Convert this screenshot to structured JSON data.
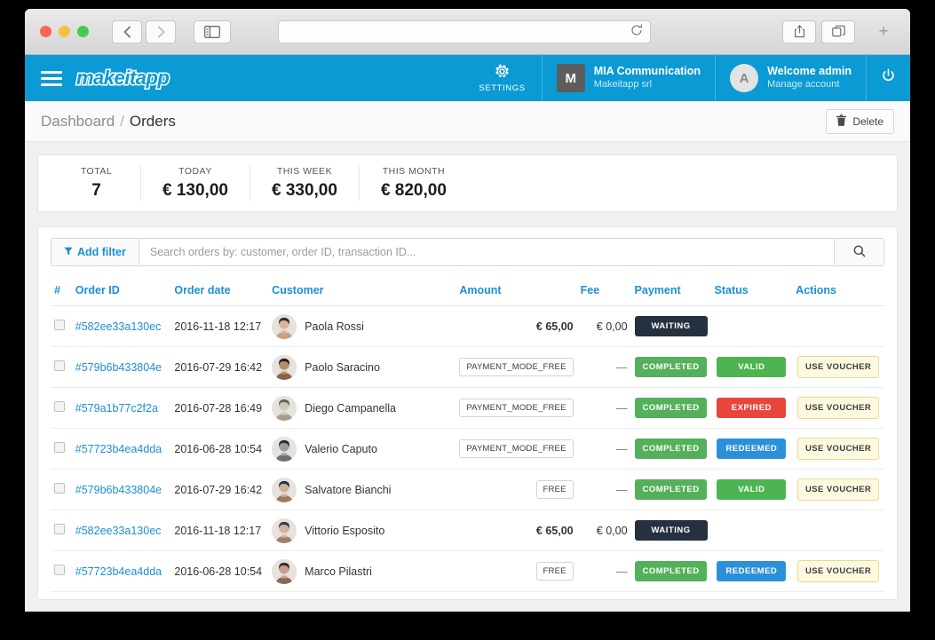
{
  "browser": {
    "back_icon": "chevron-left-icon",
    "forward_icon": "chevron-right-icon",
    "sidebar_icon": "sidebar-toggle-icon",
    "url_value": "",
    "url_placeholder": "",
    "reload_icon": "reload-icon",
    "share_icon": "share-icon",
    "tabs_icon": "show-tabs-icon",
    "new_tab_label": "+"
  },
  "navbar": {
    "brand": "makeitapp",
    "settings": {
      "label": "SETTINGS",
      "icon": "gear-icon"
    },
    "company": {
      "initial": "M",
      "name": "MIA Communication",
      "subtitle": "Makeitapp srl"
    },
    "account": {
      "initial": "A",
      "name": "Welcome admin",
      "subtitle": "Manage account"
    },
    "power": {
      "icon": "power-icon"
    },
    "menu_icon": "hamburger-menu-icon"
  },
  "breadcrumb": {
    "parent": "Dashboard",
    "separator": "/",
    "current": "Orders",
    "delete_label": "Delete",
    "delete_icon": "trash-icon"
  },
  "stats": [
    {
      "label": "TOTAL",
      "value": "7"
    },
    {
      "label": "TODAY",
      "value": "€ 130,00"
    },
    {
      "label": "THIS WEEK",
      "value": "€ 330,00"
    },
    {
      "label": "THIS MONTH",
      "value": "€ 820,00"
    }
  ],
  "filter": {
    "add_filter_label": "Add filter",
    "filter_icon": "funnel-icon",
    "search_value": "",
    "search_placeholder": "Search orders by: customer, order ID, transaction ID...",
    "search_icon": "search-icon"
  },
  "table": {
    "columns": {
      "index": "#",
      "order_id": "Order ID",
      "order_date": "Order date",
      "customer": "Customer",
      "amount": "Amount",
      "fee": "Fee",
      "payment": "Payment",
      "status": "Status",
      "actions": "Actions"
    },
    "rows": [
      {
        "order_id": "#582ee33a130ec",
        "order_date": "2016-11-18 12:17",
        "customer": "Paola Rossi",
        "avatar": "avatar-paola-rossi",
        "amount": "€ 65,00",
        "amount_is_tag": false,
        "fee": "€ 0,00",
        "payment": "WAITING",
        "payment_class": "waiting",
        "status": "",
        "status_class": "",
        "action": ""
      },
      {
        "order_id": "#579b6b433804e",
        "order_date": "2016-07-29 16:42",
        "customer": "Paolo Saracino",
        "avatar": "avatar-paolo-saracino",
        "amount": "PAYMENT_MODE_FREE",
        "amount_is_tag": true,
        "fee": "—",
        "payment": "COMPLETED",
        "payment_class": "completed",
        "status": "VALID",
        "status_class": "valid",
        "action": "USE VOUCHER"
      },
      {
        "order_id": "#579a1b77c2f2a",
        "order_date": "2016-07-28 16:49",
        "customer": "Diego Campanella",
        "avatar": "avatar-diego-campanella",
        "amount": "PAYMENT_MODE_FREE",
        "amount_is_tag": true,
        "fee": "—",
        "payment": "COMPLETED",
        "payment_class": "completed",
        "status": "EXPIRED",
        "status_class": "expired",
        "action": "USE VOUCHER"
      },
      {
        "order_id": "#57723b4ea4dda",
        "order_date": "2016-06-28 10:54",
        "customer": "Valerio Caputo",
        "avatar": "avatar-valerio-caputo",
        "amount": "PAYMENT_MODE_FREE",
        "amount_is_tag": true,
        "fee": "—",
        "payment": "COMPLETED",
        "payment_class": "completed",
        "status": "REDEEMED",
        "status_class": "redeemed",
        "action": "USE VOUCHER"
      },
      {
        "order_id": "#579b6b433804e",
        "order_date": "2016-07-29 16:42",
        "customer": "Salvatore Bianchi",
        "avatar": "avatar-salvatore-bianchi",
        "amount": "FREE",
        "amount_is_tag": true,
        "fee": "—",
        "payment": "COMPLETED",
        "payment_class": "completed",
        "status": "VALID",
        "status_class": "valid",
        "action": "USE VOUCHER"
      },
      {
        "order_id": "#582ee33a130ec",
        "order_date": "2016-11-18 12:17",
        "customer": "Vittorio Esposito",
        "avatar": "avatar-vittorio-esposito",
        "amount": "€ 65,00",
        "amount_is_tag": false,
        "fee": "€ 0,00",
        "payment": "WAITING",
        "payment_class": "waiting",
        "status": "",
        "status_class": "",
        "action": ""
      },
      {
        "order_id": "#57723b4ea4dda",
        "order_date": "2016-06-28 10:54",
        "customer": "Marco Pilastri",
        "avatar": "avatar-marco-pilastri",
        "amount": "FREE",
        "amount_is_tag": true,
        "fee": "—",
        "payment": "COMPLETED",
        "payment_class": "completed",
        "status": "REDEEMED",
        "status_class": "redeemed",
        "action": "USE VOUCHER"
      }
    ]
  },
  "colors": {
    "brand_blue": "#0b9ad4",
    "link_blue": "#1b8fd4",
    "waiting_dark": "#25313f",
    "completed_green": "#54b05a",
    "valid_green": "#4cb551",
    "expired_red": "#e8453c",
    "redeemed_blue": "#2b90d9",
    "voucher_yellow": "#fdf9e0"
  }
}
